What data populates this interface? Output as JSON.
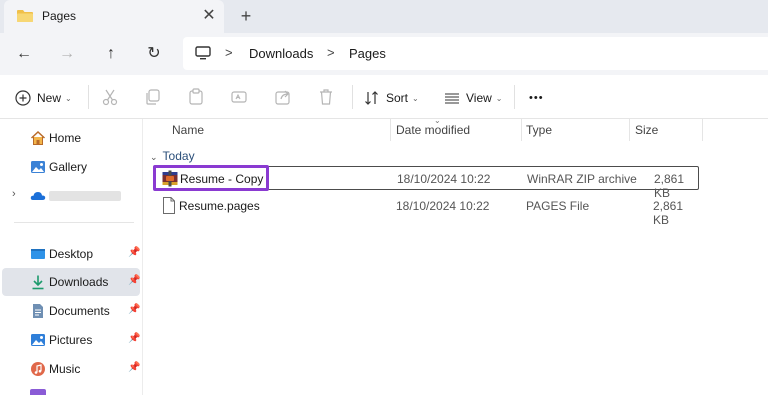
{
  "tabs": [
    {
      "label": "Pages",
      "icon": "folder-icon"
    }
  ],
  "nav": {
    "back": "back-arrow-icon",
    "forward": "forward-arrow-icon",
    "up": "up-arrow-icon",
    "refresh": "refresh-icon"
  },
  "breadcrumb": [
    "Downloads",
    "Pages"
  ],
  "toolbar": {
    "new_label": "New",
    "sort_label": "Sort",
    "view_label": "View",
    "more_label": "•••"
  },
  "sidebar": {
    "items": [
      {
        "label": "Home",
        "icon": "home-icon",
        "pinned": false
      },
      {
        "label": "Gallery",
        "icon": "gallery-icon",
        "pinned": false
      },
      {
        "label": "",
        "icon": "cloud-icon",
        "pinned": false
      },
      {
        "label": "Desktop",
        "icon": "desktop-icon",
        "pinned": true
      },
      {
        "label": "Downloads",
        "icon": "download-icon",
        "pinned": true,
        "selected": true
      },
      {
        "label": "Documents",
        "icon": "documents-icon",
        "pinned": true
      },
      {
        "label": "Pictures",
        "icon": "pictures-icon",
        "pinned": true
      },
      {
        "label": "Music",
        "icon": "music-icon",
        "pinned": true
      }
    ]
  },
  "columns": [
    "Name",
    "Date modified",
    "Type",
    "Size"
  ],
  "group_label": "Today",
  "files": [
    {
      "name": "Resume - Copy",
      "date": "18/10/2024 10:22",
      "type": "WinRAR ZIP archive",
      "size": "2,861 KB",
      "icon": "winrar-archive-icon"
    },
    {
      "name": "Resume.pages",
      "date": "18/10/2024 10:22",
      "type": "PAGES File",
      "size": "2,861 KB",
      "icon": "file-icon"
    }
  ],
  "colors": {
    "highlight": "#8a3ad1",
    "selection": "#e1e4ea",
    "group_text": "#2b4f7a"
  }
}
